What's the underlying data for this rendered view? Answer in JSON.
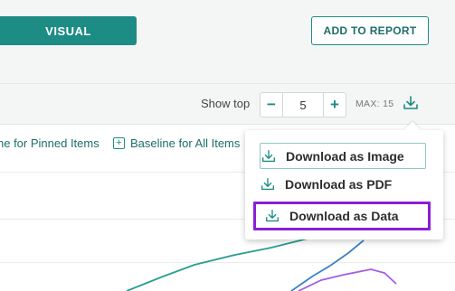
{
  "header": {
    "visual_label": "VISUAL",
    "add_to_report_label": "ADD TO REPORT"
  },
  "controls": {
    "show_top_label": "Show top",
    "decrement_symbol": "−",
    "increment_symbol": "+",
    "top_value": "5",
    "max_label": "MAX: 15"
  },
  "chart": {
    "baseline_pinned_label": "ne for Pinned Items",
    "baseline_all_label": "Baseline for All Items",
    "baseline_all_symbol": "+"
  },
  "download_menu": {
    "items": [
      {
        "label": "Download as Image",
        "icon": "download-icon"
      },
      {
        "label": "Download as PDF",
        "icon": "download-icon"
      },
      {
        "label": "Download as Data",
        "icon": "download-icon"
      }
    ]
  },
  "colors": {
    "accent": "#1d8c84",
    "highlight": "#8a1fd6",
    "series_teal": "#2a9d8f",
    "series_blue": "#3b82c4",
    "series_purple": "#a25ee0"
  }
}
